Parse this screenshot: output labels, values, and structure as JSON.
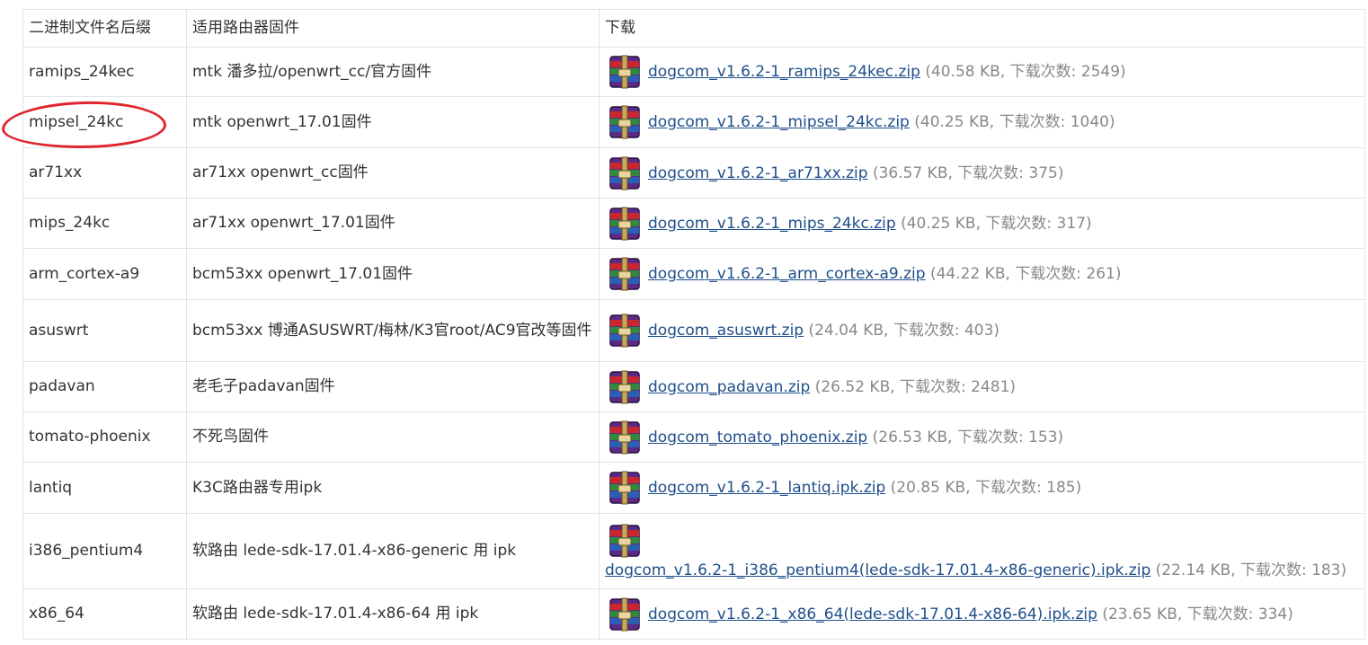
{
  "table": {
    "headers": [
      "二进制文件名后缀",
      "适用路由器固件",
      "下载"
    ],
    "rows": [
      {
        "suffix": "ramips_24kec",
        "firmware": "mtk 潘多拉/openwrt_cc/官方固件",
        "file": "dogcom_v1.6.2-1_ramips_24kec.zip",
        "meta": "(40.58 KB, 下载次数: 2549)"
      },
      {
        "suffix": "mipsel_24kc",
        "firmware": "mtk openwrt_17.01固件",
        "file": "dogcom_v1.6.2-1_mipsel_24kc.zip",
        "meta": "(40.25 KB, 下载次数: 1040)"
      },
      {
        "suffix": "ar71xx",
        "firmware": "ar71xx openwrt_cc固件",
        "file": "dogcom_v1.6.2-1_ar71xx.zip",
        "meta": "(36.57 KB, 下载次数: 375)"
      },
      {
        "suffix": "mips_24kc",
        "firmware": "ar71xx openwrt_17.01固件",
        "file": "dogcom_v1.6.2-1_mips_24kc.zip",
        "meta": "(40.25 KB, 下载次数: 317)"
      },
      {
        "suffix": "arm_cortex-a9",
        "firmware": "bcm53xx openwrt_17.01固件",
        "file": "dogcom_v1.6.2-1_arm_cortex-a9.zip",
        "meta": "(44.22 KB, 下载次数: 261)"
      },
      {
        "suffix": "asuswrt",
        "firmware": "bcm53xx 博通ASUSWRT/梅林/K3官root/AC9官改等固件",
        "file": "dogcom_asuswrt.zip",
        "meta": "(24.04 KB, 下载次数: 403)"
      },
      {
        "suffix": "padavan",
        "firmware": "老毛子padavan固件",
        "file": "dogcom_padavan.zip",
        "meta": "(26.52 KB, 下载次数: 2481)"
      },
      {
        "suffix": "tomato-phoenix",
        "firmware": "不死鸟固件",
        "file": "dogcom_tomato_phoenix.zip",
        "meta": "(26.53 KB, 下载次数: 153)"
      },
      {
        "suffix": "lantiq",
        "firmware": "K3C路由器专用ipk",
        "file": "dogcom_v1.6.2-1_lantiq.ipk.zip",
        "meta": "(20.85 KB, 下载次数: 185)"
      },
      {
        "suffix": "i386_pentium4",
        "firmware": "软路由 lede-sdk-17.01.4-x86-generic 用 ipk",
        "file": "dogcom_v1.6.2-1_i386_pentium4(lede-sdk-17.01.4-x86-generic).ipk.zip",
        "meta": "(22.14 KB, 下载次数: 183)"
      },
      {
        "suffix": "x86_64",
        "firmware": "软路由 lede-sdk-17.01.4-x86-64 用 ipk",
        "file": "dogcom_v1.6.2-1_x86_64(lede-sdk-17.01.4-x86-64).ipk.zip",
        "meta": "(23.65 KB, 下载次数: 334)"
      }
    ]
  },
  "file_icon": "winrar-archive-icon",
  "annotation": {
    "highlighted_row": 1,
    "color": "#e0242b",
    "shape": "hand-drawn-ellipse"
  },
  "colors": {
    "link": "#1f4f8a",
    "meta": "#888888",
    "border": "#dce6ee"
  }
}
